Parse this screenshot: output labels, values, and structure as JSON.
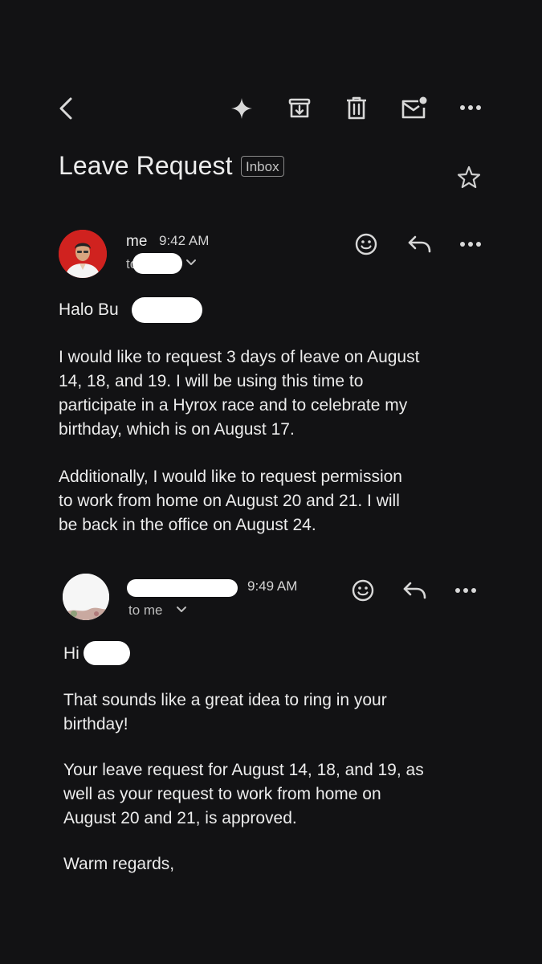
{
  "toolbar": {
    "back_icon": "arrow-back-icon",
    "icons": [
      "sparkle-icon",
      "archive-icon",
      "delete-icon",
      "mark-unread-icon",
      "more-icon"
    ]
  },
  "thread": {
    "subject": "Leave Request",
    "label": "Inbox",
    "star_icon": "star-icon"
  },
  "messages": [
    {
      "sender": "me",
      "time": "9:42 AM",
      "to": "to",
      "greeting": "Halo Bu",
      "paragraphs": [
        "I would like to request 3 days of leave on August\n14, 18, and 19. I will be using this time to\nparticipate in a Hyrox race and to celebrate my\nbirthday, which is on August 17.",
        "Additionally, I would like to request permission\nto work from home on August 20 and 21. I will\nbe back in the office on August 24."
      ]
    },
    {
      "sender": "",
      "time": "9:49 AM",
      "to": "to me",
      "greeting": "Hi",
      "paragraphs": [
        "That sounds like a great idea to ring in your\nbirthday!",
        "Your leave request for August 14, 18, and 19, as\nwell as your request to work from home on\nAugust 20 and 21, is approved.",
        "Warm regards,"
      ]
    }
  ],
  "colors": {
    "background": "#121214",
    "text": "#ececec",
    "avatar_red": "#d0221f"
  }
}
